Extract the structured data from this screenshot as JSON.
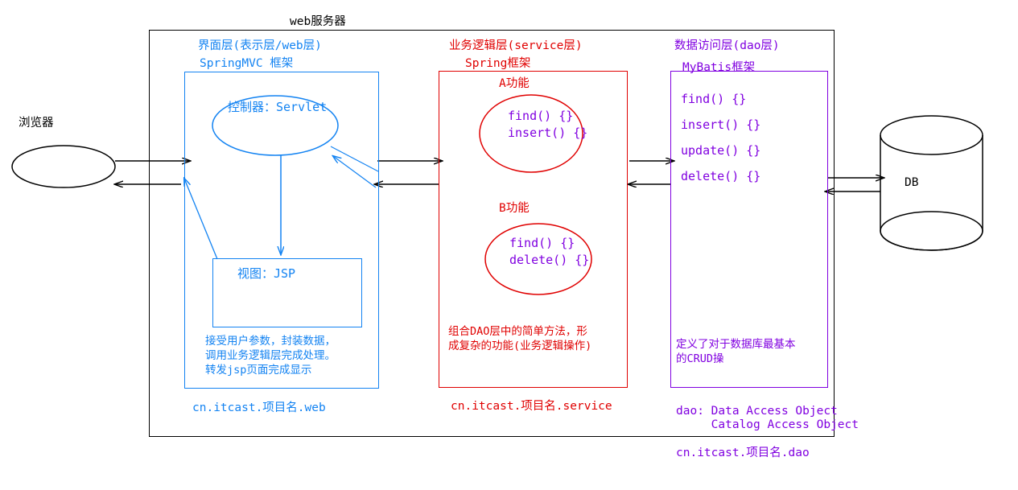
{
  "diagram": {
    "title": "web服务器",
    "actors": {
      "browser_label": "浏览器",
      "db_label": "DB"
    },
    "layers": [
      {
        "id": "web",
        "color": "#1383f2",
        "heading": "界面层(表示层/web层)",
        "framework": "SpringMVC 框架",
        "components": [
          {
            "name": "控制器：Servlet",
            "shape": "ellipse"
          },
          {
            "name": "视图：JSP",
            "shape": "rect"
          }
        ],
        "description_lines": [
          "接受用户参数，封装数据，",
          "调用业务逻辑层完成处理。",
          "转发jsp页面完成显示"
        ],
        "package": "cn.itcast.项目名.web"
      },
      {
        "id": "service",
        "color": "#e00000",
        "heading": "业务逻辑层(service层)",
        "framework": "Spring框架",
        "groups": [
          {
            "title": "A功能",
            "methods": [
              "find() {}",
              "insert() {}"
            ]
          },
          {
            "title": "B功能",
            "methods": [
              "find() {}",
              "delete() {}"
            ]
          }
        ],
        "description_lines": [
          "组合DAO层中的简单方法，形",
          "成复杂的功能(业务逻辑操作)"
        ],
        "package": "cn.itcast.项目名.service"
      },
      {
        "id": "dao",
        "color": "#8000e0",
        "heading": "数据访问层(dao层)",
        "framework": "MyBatis框架",
        "methods": [
          "find() {}",
          "insert() {}",
          "update() {}",
          "delete() {}"
        ],
        "description_lines": [
          "定义了对于数据库最基本",
          "的CRUD操"
        ],
        "acronym_lines": [
          "dao: Data Access Object",
          "     Catalog Access Object"
        ],
        "package": "cn.itcast.项目名.dao"
      }
    ],
    "method_text_color": "#8000e0"
  }
}
